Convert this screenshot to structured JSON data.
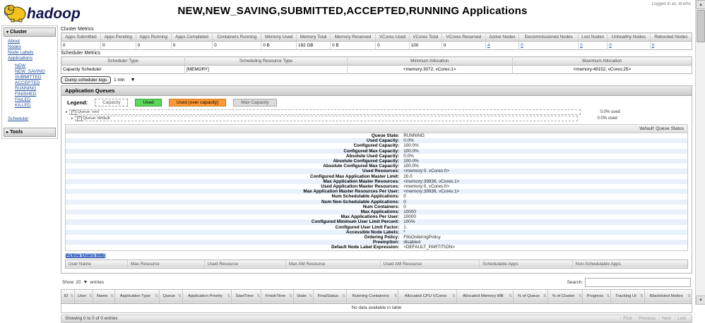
{
  "header": {
    "logo_text": "hadoop",
    "title": "NEW,NEW_SAVING,SUBMITTED,ACCEPTED,RUNNING Applications",
    "logged_in": "Logged in as: dr.who"
  },
  "sidebar": {
    "cluster_header": "Cluster",
    "tools_header": "Tools",
    "main_links": [
      "About",
      "Nodes",
      "Node Labels",
      "Applications"
    ],
    "app_states": [
      "NEW",
      "NEW_SAVING",
      "SUBMITTED",
      "ACCEPTED",
      "RUNNING",
      "FINISHED",
      "FAILED",
      "KILLED"
    ],
    "bottom_links": [
      "Scheduler"
    ]
  },
  "cluster_metrics": {
    "heading": "Cluster Metrics",
    "columns": [
      "Apps Submitted",
      "Apps Pending",
      "Apps Running",
      "Apps Completed",
      "Containers Running",
      "Memory Used",
      "Memory Total",
      "Memory Reserved",
      "VCores Used",
      "VCores Total",
      "VCores Reserved",
      "Active Nodes",
      "Decommissioned Nodes",
      "Lost Nodes",
      "Unhealthy Nodes",
      "Rebooted Nodes"
    ],
    "values": [
      "0",
      "0",
      "0",
      "0",
      "0",
      "0 B",
      "192 GB",
      "0 B",
      "0",
      "100",
      "0",
      "4",
      "0",
      "0",
      "0",
      "0"
    ]
  },
  "scheduler_metrics": {
    "heading": "Scheduler Metrics",
    "columns": [
      "Scheduler Type",
      "Scheduling Resource Type",
      "Minimum Allocation",
      "Maximum Allocation"
    ],
    "values": [
      "Capacity Scheduler",
      "[MEMORY]",
      "<memory:3072, vCores:1>",
      "<memory:49152, vCores:25>"
    ]
  },
  "toolbar": {
    "dump_button": "Dump scheduler logs",
    "interval": "1 min"
  },
  "queues": {
    "section_title": "Application Queues",
    "legend_label": "Legend:",
    "legend_capacity": "Capacity",
    "legend_used": "Used",
    "legend_over": "Used (over capacity)",
    "legend_max": "Max Capacity",
    "rows": [
      {
        "label": "Queue: root",
        "used": "0.0% used"
      },
      {
        "label": "Queue: default",
        "used": "0.0% used"
      }
    ]
  },
  "queue_status": {
    "header": "'default' Queue Status",
    "rows": [
      {
        "key": "Queue State:",
        "value": "RUNNING"
      },
      {
        "key": "Used Capacity:",
        "value": "0.0%"
      },
      {
        "key": "Configured Capacity:",
        "value": "100.0%"
      },
      {
        "key": "Configured Max Capacity:",
        "value": "100.0%"
      },
      {
        "key": "Absolute Used Capacity:",
        "value": "0.0%"
      },
      {
        "key": "Absolute Configured Capacity:",
        "value": "100.0%"
      },
      {
        "key": "Absolute Configured Max Capacity:",
        "value": "100.0%"
      },
      {
        "key": "Used Resources:",
        "value": "<memory:0, vCores:0>"
      },
      {
        "key": "Configured Max Application Master Limit:",
        "value": "20.0"
      },
      {
        "key": "Max Application Master Resources:",
        "value": "<memory:39936, vCores:1>"
      },
      {
        "key": "Used Application Master Resources:",
        "value": "<memory:0, vCores:0>"
      },
      {
        "key": "Max Application Master Resources Per User:",
        "value": "<memory:39936, vCores:1>"
      },
      {
        "key": "Num Schedulable Applications:",
        "value": "0"
      },
      {
        "key": "Num Non-Schedulable Applications:",
        "value": "0"
      },
      {
        "key": "Num Containers:",
        "value": "0"
      },
      {
        "key": "Max Applications:",
        "value": "10000"
      },
      {
        "key": "Max Applications Per User:",
        "value": "10000"
      },
      {
        "key": "Configured Minimum User Limit Percent:",
        "value": "100%"
      },
      {
        "key": "Configured User Limit Factor:",
        "value": "1"
      },
      {
        "key": "Accessible Node Labels:",
        "value": "*"
      },
      {
        "key": "Ordering Policy:",
        "value": "FifoOrderingPolicy"
      },
      {
        "key": "Preemption:",
        "value": "disabled"
      },
      {
        "key": "Default Node Label Expression:",
        "value": "<DEFAULT_PARTITION>"
      }
    ]
  },
  "active_users": {
    "title": "Active Users Info",
    "columns": [
      "User Name",
      "Max Resource",
      "Used Resource",
      "Max AM Resource",
      "Used AM Resource",
      "Schedulable Apps",
      "Non-Schedulable Apps"
    ]
  },
  "apps_table": {
    "show_label": "Show",
    "page_size": "20",
    "entries_label": "entries",
    "search_label": "Search:",
    "columns": [
      "ID",
      "User",
      "Name",
      "Application Type",
      "Queue",
      "Application Priority",
      "StartTime",
      "FinishTime",
      "State",
      "FinalStatus",
      "Running Containers",
      "Allocated CPU VCores",
      "Allocated Memory MB",
      "% of Queue",
      "% of Cluster",
      "Progress",
      "Tracking UI",
      "Blacklisted Nodes"
    ],
    "empty_message": "No data available in table",
    "summary": "Showing 0 to 0 of 0 entries",
    "pagination": [
      "First",
      "Previous",
      "Next",
      "Last"
    ]
  },
  "colors": {
    "used_green": "#5cd65c",
    "over_capacity_orange": "#ff9933",
    "link_blue": "#1f4e9c"
  }
}
